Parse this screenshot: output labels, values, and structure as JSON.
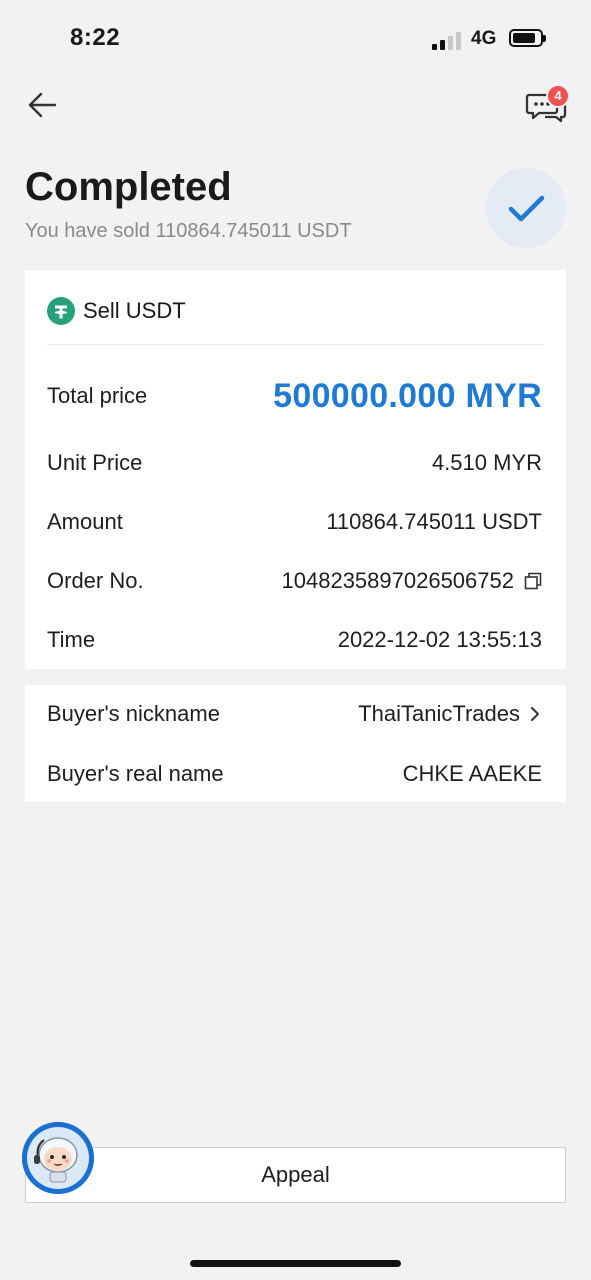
{
  "status_bar": {
    "time": "8:22",
    "network": "4G",
    "battery_level": 0.85
  },
  "header": {
    "back_icon": "arrow-left-icon",
    "chat_icon": "chat-bubbles-icon",
    "chat_badge": "4"
  },
  "status": {
    "title": "Completed",
    "subtitle": "You have sold 110864.745011 USDT",
    "icon": "checkmark-icon"
  },
  "order": {
    "header": {
      "icon": "tether-icon",
      "label": "Sell USDT"
    },
    "total_price_label": "Total price",
    "total_price_value": "500000.000 MYR",
    "unit_price_label": "Unit Price",
    "unit_price_value": "4.510 MYR",
    "amount_label": "Amount",
    "amount_value": "110864.745011 USDT",
    "order_no_label": "Order No.",
    "order_no_value": "1048235897026506752",
    "time_label": "Time",
    "time_value": "2022-12-02 13:55:13"
  },
  "buyer": {
    "nickname_label": "Buyer's nickname",
    "nickname_value": "ThaiTanicTrades",
    "real_name_label": "Buyer's real name",
    "real_name_value": "CHKE AAEKE"
  },
  "footer": {
    "appeal_label": "Appeal",
    "support_icon": "support-avatar-icon"
  },
  "colors": {
    "accent": "#1f7ad6",
    "badge": "#f0514c",
    "tether": "#26a17b",
    "background": "#f2f2f2"
  }
}
